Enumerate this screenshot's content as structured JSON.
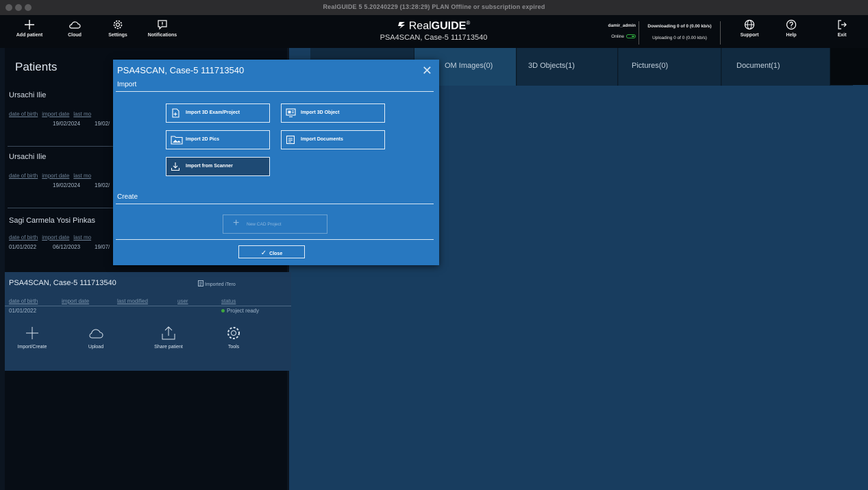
{
  "window": {
    "title": "RealGUIDE 5  5.20240229 (13:28:29)  PLAN Offline or subscription expired"
  },
  "toolbar": {
    "left_buttons": [
      {
        "label": "Add patient",
        "icon": "plus-icon"
      },
      {
        "label": "Cloud",
        "icon": "cloud-icon"
      },
      {
        "label": "Settings",
        "icon": "gear-icon"
      },
      {
        "label": "Notifications",
        "icon": "notification-icon"
      }
    ],
    "brand_prefix": "Real",
    "brand_suffix": "GUIDE",
    "brand_mark": "®",
    "case_title": "PSA4SCAN, Case-5 111713540",
    "user_name": "damir_admin",
    "online_label": "Online",
    "downloading": "Downloading 0 of 0 (0.00 kb/s)",
    "uploading": "Uploading 0 of 0 (0.00 kb/s)",
    "right_buttons": [
      {
        "label": "Support",
        "icon": "globe-icon"
      },
      {
        "label": "Help",
        "icon": "help-icon"
      },
      {
        "label": "Exit",
        "icon": "exit-icon"
      }
    ]
  },
  "patients_panel": {
    "title": "Patients",
    "patients": [
      {
        "name": "Ursachi Ilie",
        "dob_label": "date of birth",
        "import_label": "import date",
        "modified_label": "last mo",
        "dob": "",
        "import_date": "19/02/2024",
        "modified": "19/02/"
      },
      {
        "name": "Ursachi Ilie",
        "dob_label": "date of birth",
        "import_label": "import date",
        "modified_label": "last mo",
        "dob": "",
        "import_date": "19/02/2024",
        "modified": "19/02/"
      },
      {
        "name": "Sagi Carmela Yosi Pinkas",
        "dob_label": "date of birth",
        "import_label": "import date",
        "modified_label": "last mo",
        "dob": "01/01/2022",
        "import_date": "06/12/2023",
        "modified": "19/07/"
      }
    ],
    "active": {
      "name": "PSA4SCAN, Case-5 111713540",
      "source": "Imported iTero",
      "headers": [
        "date of birth",
        "import date",
        "last modified",
        "user",
        "status"
      ],
      "dob": "01/01/2022",
      "status": "Project ready",
      "actions": [
        {
          "label": "Import/Create",
          "icon": "plus-icon"
        },
        {
          "label": "Upload",
          "icon": "cloud-icon"
        },
        {
          "label": "Share patient",
          "icon": "share-icon"
        },
        {
          "label": "Tools",
          "icon": "gear-icon"
        }
      ]
    }
  },
  "tabs": [
    {
      "label": ""
    },
    {
      "label": "OM Images(0)"
    },
    {
      "label": "3D Objects(1)"
    },
    {
      "label": "Pictures(0)"
    },
    {
      "label": "Document(1)"
    }
  ],
  "modal": {
    "title": "PSA4SCAN, Case-5  111713540",
    "import_section": "Import",
    "create_section": "Create",
    "buttons": {
      "import_3d_exam": "Import 3D Exam/Project",
      "import_3d_object": "Import 3D Object",
      "import_2d_pics": "Import 2D Pics",
      "import_documents": "Import Documents",
      "import_scanner": "Import from Scanner",
      "new_cad": "New CAD Project",
      "close": "Close"
    }
  },
  "colors": {
    "modal_bg": "#2878c0",
    "content_bg": "#183d5f",
    "status_green": "#3ea63e"
  }
}
